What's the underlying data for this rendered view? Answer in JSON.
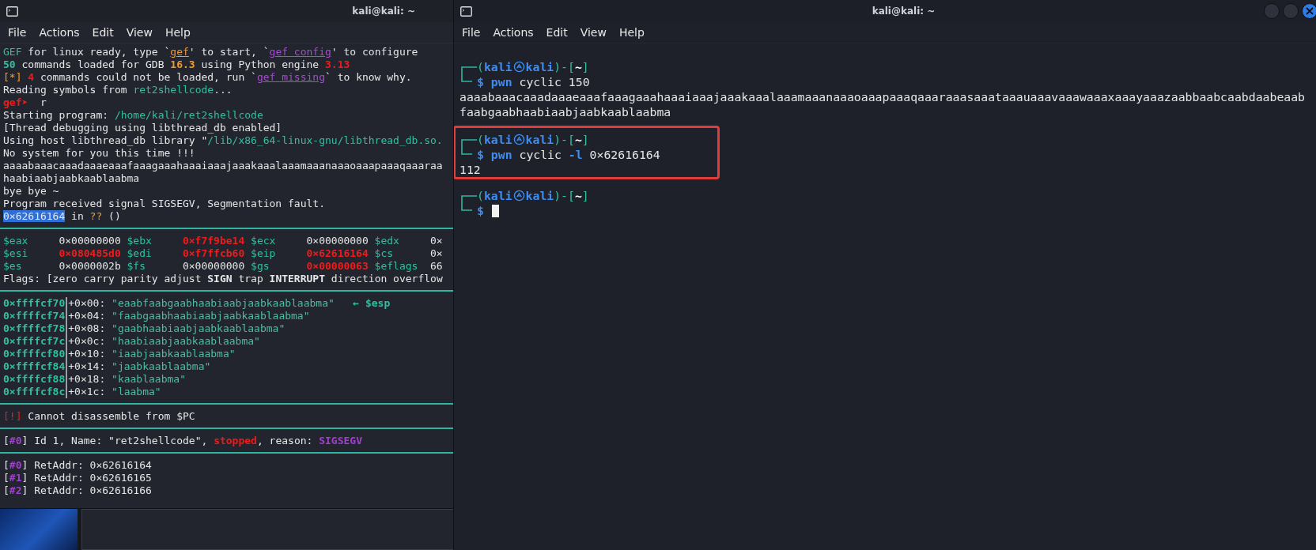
{
  "left_window": {
    "title": "kali@kali: ~",
    "menu": [
      "File",
      "Actions",
      "Edit",
      "View",
      "Help"
    ],
    "blocks": [
      {
        "kind": "lines",
        "lines": [
          [
            {
              "kind": "text",
              "text": "GEF",
              "color": "#2fc0a0"
            },
            {
              "kind": "text",
              "text": " for linux ready, type `"
            },
            {
              "kind": "link",
              "text": "gef",
              "color": "#f29a2e"
            },
            {
              "kind": "text",
              "text": "' to start, `"
            },
            {
              "kind": "link",
              "text": "gef config",
              "color": "#a54bcf"
            },
            {
              "kind": "text",
              "text": "' to configure"
            }
          ],
          [
            {
              "kind": "text",
              "text": "**50**",
              "color": "#2fc0a0"
            },
            {
              "kind": "text",
              "text": " commands loaded for GDB "
            },
            {
              "kind": "text",
              "text": "**16.3**",
              "color": "#f29a2e"
            },
            {
              "kind": "text",
              "text": " using Python engine "
            },
            {
              "kind": "text",
              "text": "**3.13**",
              "color": "#ee1c1c"
            }
          ],
          [
            {
              "kind": "text",
              "text": "[*]",
              "color": "#f29a2e"
            },
            {
              "kind": "text",
              "text": " **4**",
              "color": "#ee1c1c"
            },
            {
              "kind": "text",
              "text": " commands could not be loaded, run `"
            },
            {
              "kind": "link",
              "text": "gef missing",
              "color": "#a54bcf"
            },
            {
              "kind": "text",
              "text": "` to know why."
            }
          ],
          [
            {
              "kind": "text",
              "text": "Reading symbols from "
            },
            {
              "kind": "text",
              "text": "ret2shellcode",
              "color": "#2fc0a0"
            },
            {
              "kind": "text",
              "text": "..."
            }
          ],
          [
            {
              "kind": "text",
              "text": "**gef➤**",
              "color": "#ee1c1c"
            },
            {
              "kind": "text",
              "text": "  r"
            }
          ],
          [
            {
              "kind": "text",
              "text": "Starting program: "
            },
            {
              "kind": "text",
              "text": "/home/kali/ret2shellcode",
              "color": "#2fc0a0"
            }
          ],
          [
            {
              "kind": "text",
              "text": "[Thread debugging using libthread_db enabled]"
            }
          ],
          [
            {
              "kind": "text",
              "text": "Using host libthread_db library \""
            },
            {
              "kind": "text",
              "text": "/lib/x86_64-linux-gnu/libthread_db.so.",
              "color": "#2fc0a0"
            }
          ],
          [
            {
              "kind": "text",
              "text": "No system for you this time !!!"
            }
          ],
          [
            {
              "kind": "text",
              "text": "aaaabaaacaaadaaaeaaafaaagaaahaaaiaaajaaakaaalaaamaaanaaaoaaapaaaqaaaraa"
            }
          ],
          [
            {
              "kind": "text",
              "text": "haabiaabjaabkaablaabma"
            }
          ],
          [
            {
              "kind": "text",
              "text": "bye bye ~"
            }
          ],
          [
            {
              "kind": "text",
              "text": "Program received signal SIGSEGV, Segmentation fault."
            }
          ],
          [
            {
              "kind": "highlight",
              "text": "0×62616164"
            },
            {
              "kind": "text",
              "text": " in "
            },
            {
              "kind": "text",
              "text": "??",
              "color": "#f0a030"
            },
            {
              "kind": "text",
              "text": " ()"
            }
          ]
        ]
      },
      {
        "kind": "registers",
        "registers": [
          {
            "name": "$eax",
            "value": "0×00000000",
            "changed": false
          },
          {
            "name": "$ebx",
            "value": "0×f7f9be14",
            "changed": true
          },
          {
            "name": "$ecx",
            "value": "0×00000000",
            "changed": false
          },
          {
            "name": "$edx",
            "value": "0×",
            "changed": false
          },
          {
            "name": "$esi",
            "value": "0×080485d0",
            "changed": true
          },
          {
            "name": "$edi",
            "value": "0×f7ffcb60",
            "changed": true
          },
          {
            "name": "$eip",
            "value": "0×62616164",
            "changed": true
          },
          {
            "name": "$cs",
            "value": "0×",
            "changed": false
          },
          {
            "name": "$es",
            "value": "0×0000002b",
            "changed": false
          },
          {
            "name": "$fs",
            "value": "0×00000000",
            "changed": false
          },
          {
            "name": "$gs",
            "value": "0×00000063",
            "changed": true
          },
          {
            "name": "$eflags",
            "value": "66",
            "changed": false
          }
        ],
        "flags": "Flags: [zero carry parity adjust **SIGN** trap **INTERRUPT** direction overflow"
      },
      {
        "kind": "stack",
        "rows": [
          {
            "address": "0×ffffcf70",
            "offset": "+0×00:",
            "value": "\"eaabfaabgaabhaabiaabjaabkaablaabma\"",
            "pointer": "← $esp"
          },
          {
            "address": "0×ffffcf74",
            "offset": "+0×04:",
            "value": "\"faabgaabhaabiaabjaabkaablaabma\""
          },
          {
            "address": "0×ffffcf78",
            "offset": "+0×08:",
            "value": "\"gaabhaabiaabjaabkaablaabma\""
          },
          {
            "address": "0×ffffcf7c",
            "offset": "+0×0c:",
            "value": "\"haabiaabjaabkaablaabma\""
          },
          {
            "address": "0×ffffcf80",
            "offset": "+0×10:",
            "value": "\"iaabjaabkaablaabma\""
          },
          {
            "address": "0×ffffcf84",
            "offset": "+0×14:",
            "value": "\"jaabkaablaabma\""
          },
          {
            "address": "0×ffffcf88",
            "offset": "+0×18:",
            "value": "\"kaablaabma\""
          },
          {
            "address": "0×ffffcf8c",
            "offset": "+0×1c:",
            "value": "\"laabma\""
          }
        ]
      },
      {
        "kind": "lines",
        "lines": [
          [
            {
              "kind": "text",
              "text": "[!]",
              "color": "#ee1c1c"
            },
            {
              "kind": "text",
              "text": " Cannot disassemble from $PC"
            }
          ]
        ]
      },
      {
        "kind": "lines",
        "lines": [
          [
            {
              "kind": "text",
              "text": "["
            },
            {
              "kind": "text",
              "text": "**#0**",
              "color": "#a33fd1"
            },
            {
              "kind": "text",
              "text": "] Id 1, Name: \"ret2shellcode\", "
            },
            {
              "kind": "text",
              "text": "**stopped**",
              "color": "#ee1c1c"
            },
            {
              "kind": "text",
              "text": ", reason: "
            },
            {
              "kind": "text",
              "text": "**SIGSEGV**",
              "color": "#a33fd1"
            }
          ]
        ]
      },
      {
        "kind": "lines",
        "lines": [
          [
            {
              "kind": "text",
              "text": "["
            },
            {
              "kind": "text",
              "text": "**#0**",
              "color": "#a33fd1"
            },
            {
              "kind": "text",
              "text": "] RetAddr: 0×62616164"
            }
          ],
          [
            {
              "kind": "text",
              "text": "["
            },
            {
              "kind": "text",
              "text": "**#1**",
              "color": "#a33fd1"
            },
            {
              "kind": "text",
              "text": "] RetAddr: 0×62616165"
            }
          ],
          [
            {
              "kind": "text",
              "text": "["
            },
            {
              "kind": "text",
              "text": "**#2**",
              "color": "#a33fd1"
            },
            {
              "kind": "text",
              "text": "] RetAddr: 0×62616166"
            }
          ]
        ]
      }
    ]
  },
  "right_window": {
    "title": "kali@kali: ~",
    "menu": [
      "File",
      "Actions",
      "Edit",
      "View",
      "Help"
    ],
    "lines": [
      {
        "kind": "prompt",
        "open": "(",
        "user": "kali",
        "host": "kali",
        "mid": ")-[",
        "cwd": "~",
        "close": "]"
      },
      {
        "kind": "command",
        "sign": "$",
        "segments": [
          {
            "text": "pwn",
            "color": "#3d8df2"
          },
          {
            "text": " cyclic 150"
          }
        ]
      },
      {
        "kind": "output",
        "text": "aaaabaaacaaadaaaeaaafaaagaaahaaaiaaajaaakaaalaaamaaanaaaoaaapaaaqaaaraaasaaataaauaaavaaawaaaxaaayaaazaabbaabcaabdaabeaab"
      },
      {
        "kind": "output",
        "text": "faabgaabhaabiaabjaabkaablaabma"
      },
      {
        "kind": "annotation",
        "lines": [
          {
            "kind": "prompt",
            "open": "(",
            "user": "kali",
            "host": "kali",
            "mid": ")-[",
            "cwd": "~",
            "close": "]"
          },
          {
            "kind": "command",
            "sign": "$",
            "segments": [
              {
                "text": "pwn",
                "color": "#3d8df2"
              },
              {
                "text": " cyclic "
              },
              {
                "text": "-l",
                "color": "#3d8df2"
              },
              {
                "text": " 0×62616164"
              }
            ]
          },
          {
            "kind": "output",
            "text": "112"
          }
        ]
      },
      {
        "kind": "prompt",
        "open": "(",
        "user": "kali",
        "host": "kali",
        "mid": ")-[",
        "cwd": "~",
        "close": "]"
      },
      {
        "kind": "command",
        "sign": "$",
        "cursor": true
      }
    ]
  }
}
